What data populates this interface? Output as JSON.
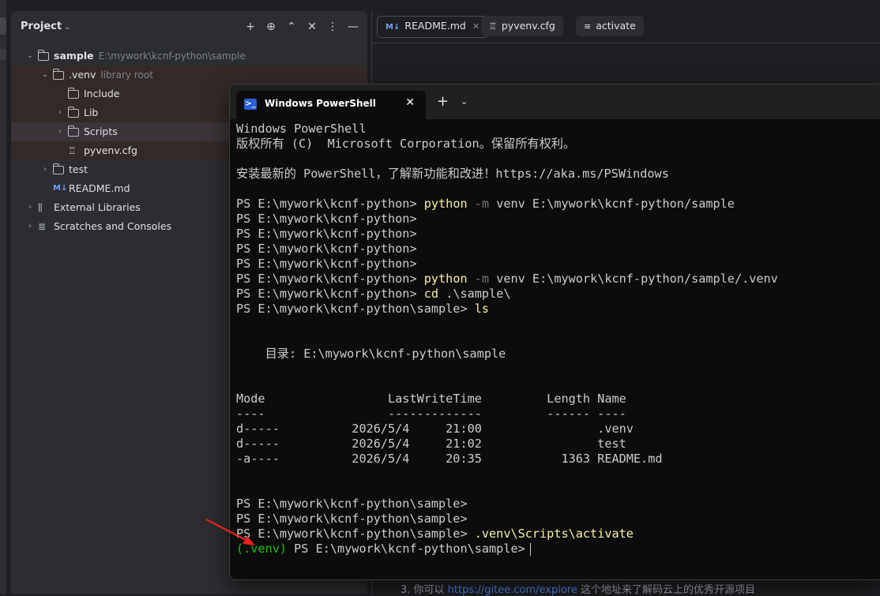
{
  "project_panel": {
    "title": "Project",
    "tree": [
      {
        "name": "sample",
        "hint": "E:\\mywork\\kcnf-python\\sample",
        "depth": 0,
        "expanded": true,
        "kind": "module",
        "bold": true
      },
      {
        "name": ".venv",
        "hint": "library root",
        "depth": 1,
        "expanded": true,
        "kind": "folder"
      },
      {
        "name": "Include",
        "hint": "",
        "depth": 2,
        "kind": "folder"
      },
      {
        "name": "Lib",
        "hint": "",
        "depth": 2,
        "collapsed": true,
        "kind": "folder"
      },
      {
        "name": "Scripts",
        "hint": "",
        "depth": 2,
        "collapsed": true,
        "kind": "folder",
        "selected": true
      },
      {
        "name": "pyvenv.cfg",
        "hint": "",
        "depth": 2,
        "kind": "cfg"
      },
      {
        "name": "test",
        "hint": "",
        "depth": 1,
        "collapsed": true,
        "kind": "folder"
      },
      {
        "name": "README.md",
        "hint": "",
        "depth": 1,
        "kind": "md"
      },
      {
        "name": "External Libraries",
        "hint": "",
        "depth": 0,
        "collapsed": true,
        "kind": "lib"
      },
      {
        "name": "Scratches and Consoles",
        "hint": "",
        "depth": 0,
        "collapsed": true,
        "kind": "scratch"
      }
    ]
  },
  "editor": {
    "tabs": [
      {
        "label": "README.md",
        "icon": "markdown-icon",
        "glyph": "M↓",
        "active": true
      },
      {
        "label": "pyvenv.cfg",
        "icon": "config-icon",
        "glyph": "♖"
      },
      {
        "label": "activate",
        "icon": "text-file-icon",
        "glyph": "≡"
      }
    ],
    "footer_prefix": "3. 你可以 ",
    "footer_link": "https://gitee.com/explore",
    "footer_suffix": " 这个地址来了解码云上的优秀开源项目"
  },
  "terminal": {
    "tab_title": "Windows PowerShell",
    "lines": [
      [
        {
          "t": "Windows PowerShell"
        }
      ],
      [
        {
          "t": "版权所有 (C)  Microsoft Corporation。保留所有权利。"
        }
      ],
      [
        {
          "t": ""
        }
      ],
      [
        {
          "t": "安装最新的 PowerShell，了解新功能和改进！https://aka.ms/PSWindows"
        }
      ],
      [
        {
          "t": ""
        }
      ],
      [
        {
          "t": "PS E:\\mywork\\kcnf-python> "
        },
        {
          "t": "python",
          "c": "cmd"
        },
        {
          "t": " -m",
          "c": "param"
        },
        {
          "t": " venv E:\\mywork\\kcnf-python/sample"
        }
      ],
      [
        {
          "t": "PS E:\\mywork\\kcnf-python>"
        }
      ],
      [
        {
          "t": "PS E:\\mywork\\kcnf-python>"
        }
      ],
      [
        {
          "t": "PS E:\\mywork\\kcnf-python>"
        }
      ],
      [
        {
          "t": "PS E:\\mywork\\kcnf-python>"
        }
      ],
      [
        {
          "t": "PS E:\\mywork\\kcnf-python> "
        },
        {
          "t": "python",
          "c": "cmd"
        },
        {
          "t": " -m",
          "c": "param"
        },
        {
          "t": " venv E:\\mywork\\kcnf-python/sample/.venv"
        }
      ],
      [
        {
          "t": "PS E:\\mywork\\kcnf-python> "
        },
        {
          "t": "cd",
          "c": "cmd"
        },
        {
          "t": " .\\sample\\"
        }
      ],
      [
        {
          "t": "PS E:\\mywork\\kcnf-python\\sample> "
        },
        {
          "t": "ls",
          "c": "cmd"
        }
      ],
      [
        {
          "t": ""
        }
      ],
      [
        {
          "t": ""
        }
      ],
      [
        {
          "t": "    目录: E:\\mywork\\kcnf-python\\sample"
        }
      ],
      [
        {
          "t": ""
        }
      ],
      [
        {
          "t": ""
        }
      ],
      [
        {
          "t": "Mode                 LastWriteTime         Length Name"
        }
      ],
      [
        {
          "t": "----                 -------------         ------ ----"
        }
      ],
      [
        {
          "t": "d-----          2026/5/4     21:00                .venv"
        }
      ],
      [
        {
          "t": "d-----          2026/5/4     21:02                test"
        }
      ],
      [
        {
          "t": "-a----          2026/5/4     20:35           1363 README.md"
        }
      ],
      [
        {
          "t": ""
        }
      ],
      [
        {
          "t": ""
        }
      ],
      [
        {
          "t": "PS E:\\mywork\\kcnf-python\\sample>"
        }
      ],
      [
        {
          "t": "PS E:\\mywork\\kcnf-python\\sample>"
        }
      ],
      [
        {
          "t": "PS E:\\mywork\\kcnf-python\\sample> "
        },
        {
          "t": ".venv\\Scripts\\activate",
          "c": "cmd"
        }
      ],
      [
        {
          "t": "(.venv)",
          "c": "venv"
        },
        {
          "t": " PS E:\\mywork\\kcnf-python\\sample>"
        }
      ]
    ]
  },
  "colors": {
    "command": "#f9f1a5",
    "parameter": "#767676",
    "venv_prompt": "#16c60c",
    "annotation_arrow": "#e8231e"
  }
}
